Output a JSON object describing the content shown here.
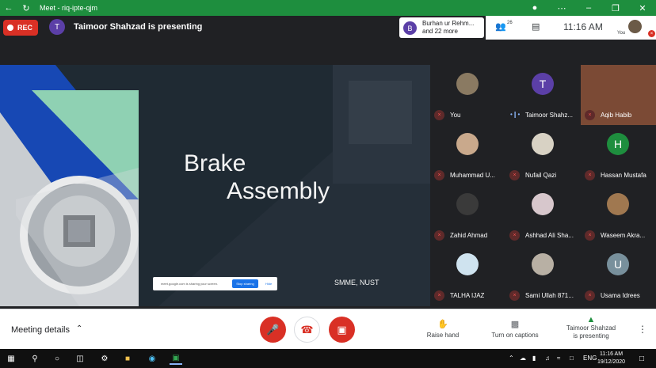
{
  "window": {
    "title": "Meet - riq-ipte-qjm"
  },
  "header": {
    "rec_label": "REC",
    "presenter_initial": "T",
    "presenting_text": "Taimoor Shahzad is presenting",
    "notification": {
      "initial": "B",
      "line1": "Burhan ur Rehm...",
      "line2": "and 22 more"
    },
    "people_count": "26",
    "time": "11:16 AM",
    "self_label": "You"
  },
  "slide": {
    "title_line1": "Brake",
    "title_line2": "Assembly",
    "footer": "SMME, NUST",
    "share_bar": {
      "text": "meet.google.com is sharing your screen.",
      "stop_label": "Stop sharing",
      "hide_label": "Hide"
    }
  },
  "participants": [
    {
      "name": "You",
      "initial": "",
      "color": "#8a7a62",
      "muted": true
    },
    {
      "name": "Taimoor Shahz...",
      "initial": "T",
      "color": "#5b3fa7",
      "muted": false,
      "speaking": true
    },
    {
      "name": "Aqib Habib",
      "initial": "",
      "color": "#7b4a35",
      "muted": true,
      "video": true
    },
    {
      "name": "Muhammad U...",
      "initial": "",
      "color": "#c9a98c",
      "muted": true
    },
    {
      "name": "Nufail Qazi",
      "initial": "",
      "color": "#d8d2c4",
      "muted": true
    },
    {
      "name": "Hassan Mustafa",
      "initial": "H",
      "color": "#1e8e3e",
      "muted": true
    },
    {
      "name": "Zahid Ahmad",
      "initial": "",
      "color": "#3a3a3a",
      "muted": true
    },
    {
      "name": "Ashhad Ali Sha...",
      "initial": "",
      "color": "#d7c7cc",
      "muted": true
    },
    {
      "name": "Waseem Akra...",
      "initial": "",
      "color": "#a07850",
      "muted": true
    },
    {
      "name": "TALHA IJAZ",
      "initial": "",
      "color": "#cfe3ef",
      "muted": true
    },
    {
      "name": "Sami Ullah 871...",
      "initial": "",
      "color": "#b8b0a4",
      "muted": true
    },
    {
      "name": "Usama Idrees",
      "initial": "U",
      "color": "#78909c",
      "muted": true
    }
  ],
  "bottom": {
    "meeting_details": "Meeting details",
    "raise_hand": "Raise hand",
    "captions": "Turn on captions",
    "presenting_line1": "Taimoor Shahzad",
    "presenting_line2": "is presenting"
  },
  "taskbar": {
    "lang": "ENG",
    "time": "11:16 AM",
    "date": "19/12/2020"
  },
  "colors": {
    "meet_green": "#1e8e3e",
    "danger_red": "#d93025",
    "dark_bg": "#202124"
  },
  "icons": [
    "back-arrow-icon",
    "refresh-icon",
    "mic-off-icon",
    "camera-off-icon",
    "hangup-icon",
    "people-icon",
    "chat-icon",
    "hand-icon",
    "captions-icon",
    "present-icon",
    "more-icon",
    "windows-icon",
    "search-icon"
  ]
}
